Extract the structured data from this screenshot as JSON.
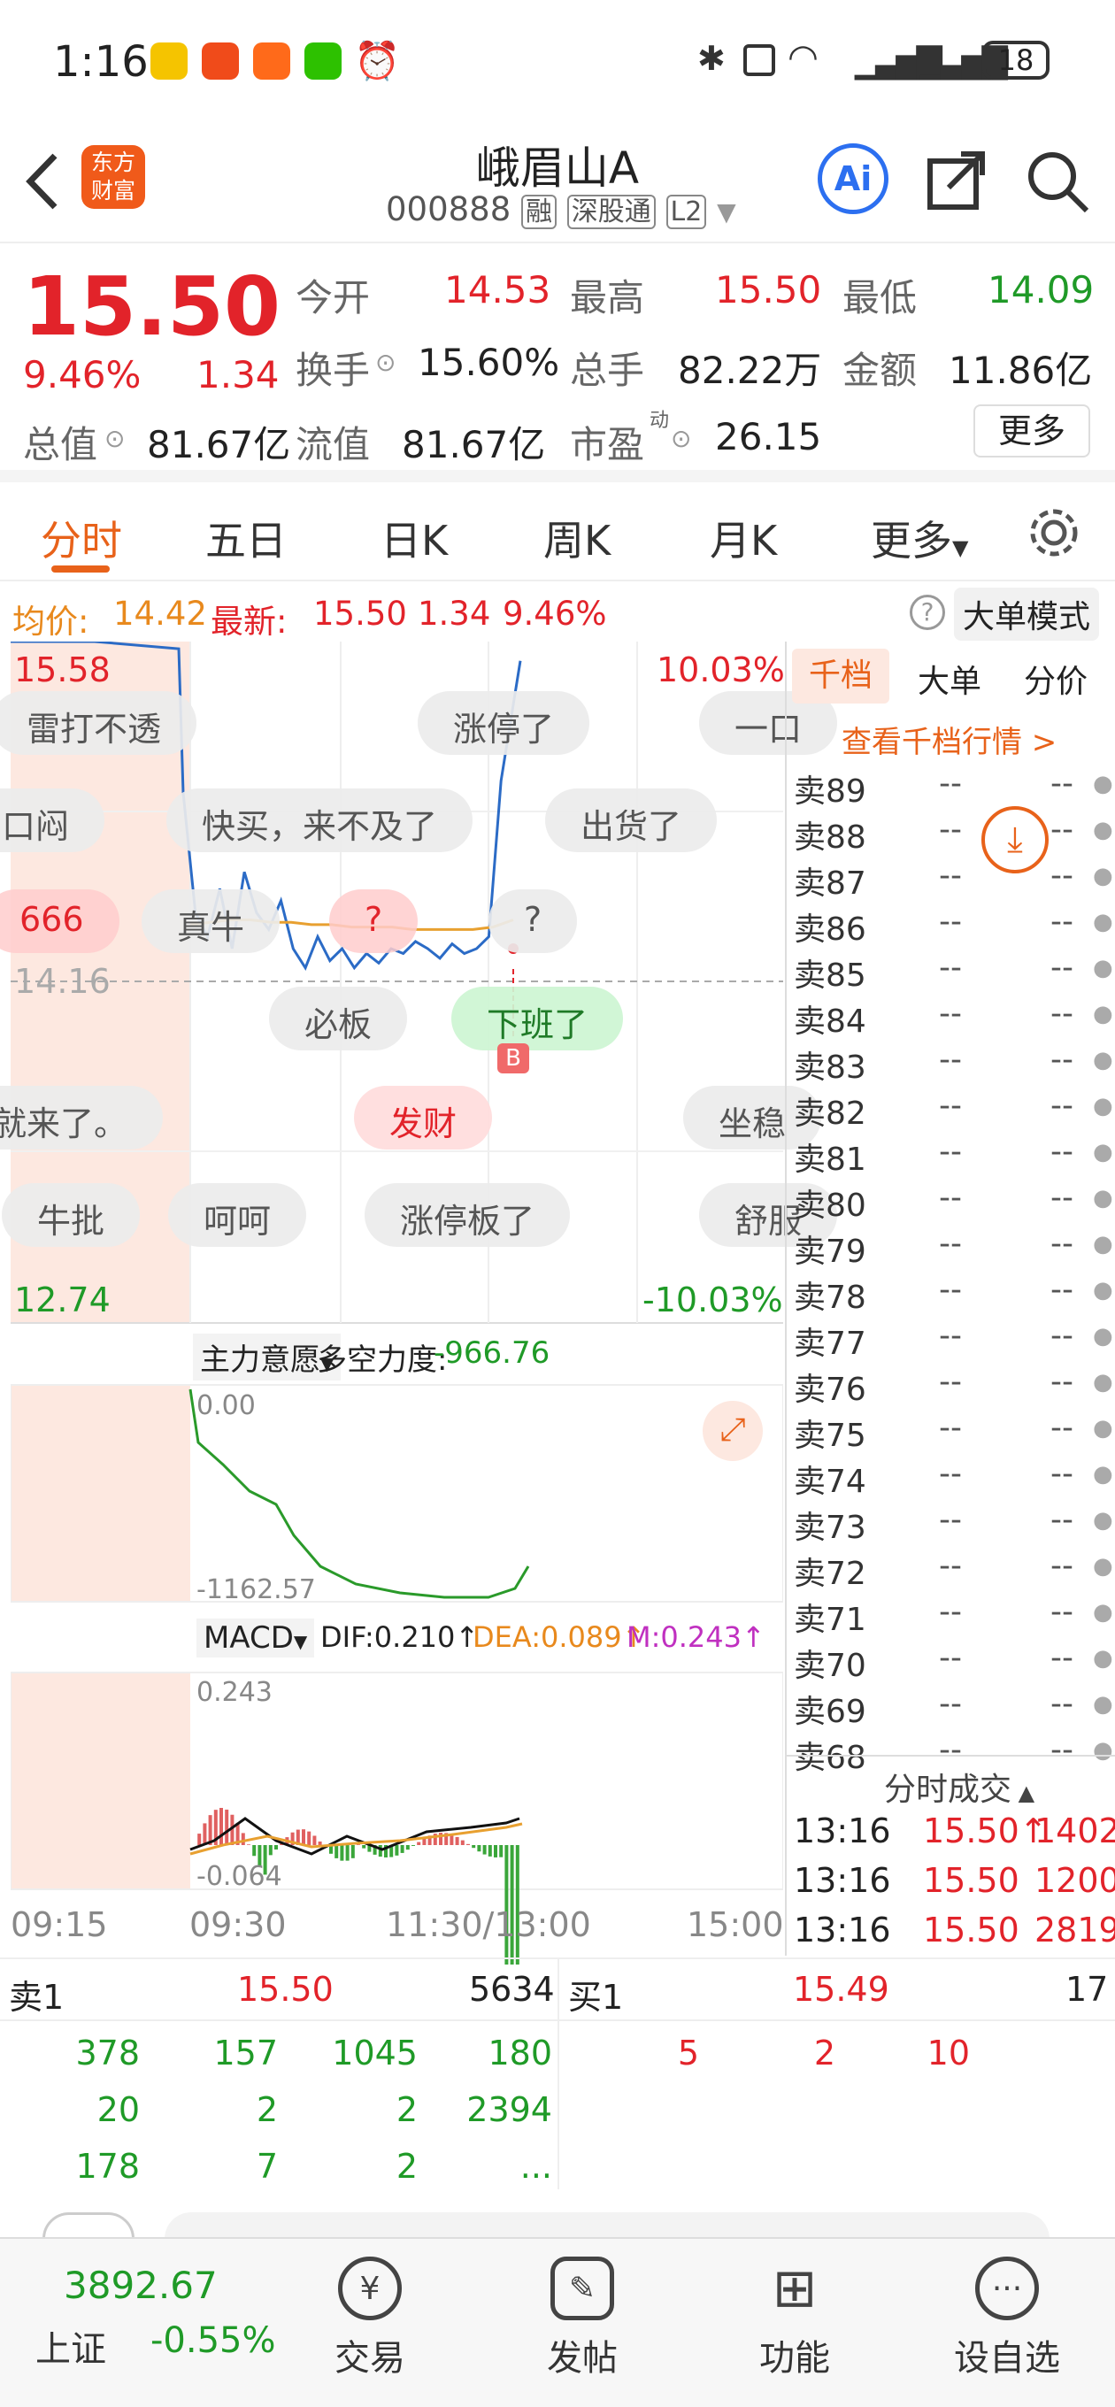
{
  "status": {
    "time": "1:16",
    "battery": "18"
  },
  "header": {
    "title": "峨眉山A",
    "code": "000888",
    "tags": [
      "融",
      "深股通",
      "L2"
    ],
    "logo_line1": "东方",
    "logo_line2": "财富",
    "ai": "Ai"
  },
  "quote": {
    "price": "15.50",
    "pct": "9.46%",
    "chg": "1.34",
    "open_label": "今开",
    "open": "14.53",
    "high_label": "最高",
    "high": "15.50",
    "low_label": "最低",
    "low": "14.09",
    "turnover_label": "换手",
    "turnover": "15.60%",
    "vol_label": "总手",
    "vol": "82.22万",
    "amount_label": "金额",
    "amount": "11.86亿",
    "cap_label": "总值",
    "cap": "81.67亿",
    "float_label": "流值",
    "float": "81.67亿",
    "pe_label": "市盈",
    "pe_sup": "动",
    "pe": "26.15",
    "more": "更多"
  },
  "tabs": [
    "分时",
    "五日",
    "日K",
    "周K",
    "月K",
    "更多"
  ],
  "info": {
    "avg_label": "均价:",
    "avg": "14.42",
    "latest_label": "最新:",
    "latest": "15.50",
    "chg": "1.34",
    "pct": "9.46%",
    "mode": "大单模式"
  },
  "chart_data": {
    "type": "line",
    "price_axis": {
      "top": "15.58",
      "top_pct": "10.03%",
      "bottom": "12.74",
      "bottom_pct": "-10.03%",
      "ref": "14.16"
    },
    "time_labels": [
      "09:15",
      "09:30",
      "11:30/13:00",
      "15:00"
    ],
    "series": [
      {
        "values": [
          15.58,
          15.58,
          15.55,
          14.95,
          14.45,
          14.35,
          14.55,
          14.3,
          14.62,
          14.45,
          14.38,
          14.5,
          14.3,
          14.22,
          14.35,
          14.25,
          14.3,
          14.22,
          14.28,
          14.24,
          14.3,
          14.28,
          14.33,
          14.3,
          14.26,
          14.32,
          14.28,
          14.3,
          14.35,
          15.0,
          15.5
        ]
      },
      {
        "values": [
          14.4,
          14.41,
          14.42,
          14.42,
          14.41,
          14.41,
          14.4,
          14.4,
          14.39,
          14.39,
          14.39,
          14.38,
          14.38,
          14.38,
          14.38,
          14.39,
          14.42
        ]
      }
    ],
    "ind1": {
      "label": "主力意愿",
      "force_label": "多空力度:",
      "force": "-966.76",
      "top": "0.00",
      "bottom": "-1162.57"
    },
    "macd": {
      "label": "MACD",
      "dif": "DIF:0.210↑",
      "dea": "DEA:0.089↑",
      "m": "M:0.243↑",
      "top": "0.243",
      "bottom": "-0.064"
    }
  },
  "bubbles": [
    "雷打不透",
    "涨停了",
    "一口",
    "口闷",
    "快买，来不及了",
    "出货了",
    "666",
    "真牛",
    "?",
    "?",
    "必板",
    "下班了",
    "就来了。",
    "发财",
    "坐稳",
    "牛批",
    "呵呵",
    "涨停板了",
    "舒服"
  ],
  "badge": "B",
  "orderbook": {
    "tabs": [
      "千档",
      "大单",
      "分价"
    ],
    "link": "查看千档行情 >",
    "sells": [
      "卖89",
      "卖88",
      "卖87",
      "卖86",
      "卖85",
      "卖84",
      "卖83",
      "卖82",
      "卖81",
      "卖80",
      "卖79",
      "卖78",
      "卖77",
      "卖76",
      "卖75",
      "卖74",
      "卖73",
      "卖72",
      "卖71",
      "卖70",
      "卖69",
      "卖68"
    ],
    "dash": "--",
    "trades_title": "分时成交",
    "trades": [
      {
        "t": "13:16",
        "p": "15.50↑",
        "v": "1402"
      },
      {
        "t": "13:16",
        "p": "15.50",
        "v": "1200"
      },
      {
        "t": "13:16",
        "p": "15.50",
        "v": "2819"
      }
    ]
  },
  "book": {
    "sell_label": "卖1",
    "sell_price": "15.50",
    "sell_vol": "5634",
    "buy_label": "买1",
    "buy_price": "15.49",
    "buy_vol": "17",
    "sell_rows": [
      [
        "378",
        "157",
        "1045",
        "180"
      ],
      [
        "20",
        "2",
        "2",
        "2394"
      ],
      [
        "178",
        "7",
        "2",
        "..."
      ]
    ],
    "buy_rows": [
      [
        "5",
        "2",
        "10"
      ]
    ]
  },
  "nav": {
    "index": "3892.67",
    "index_label": "上证",
    "index_pct": "-0.55%",
    "items": [
      "交易",
      "发帖",
      "功能",
      "设自选"
    ]
  }
}
